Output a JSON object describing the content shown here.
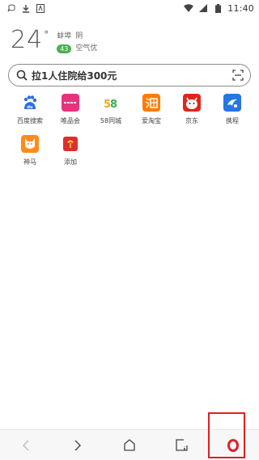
{
  "status_bar": {
    "time": "11:40"
  },
  "weather": {
    "temperature": "24",
    "degree_symbol": "°",
    "city": "蚌埠",
    "condition": "阴",
    "aqi_value": "43",
    "aqi_text": "空气优"
  },
  "search": {
    "text": "拉1人住院给300元"
  },
  "speed_dials": [
    {
      "label": "百度搜索",
      "icon": "baidu-icon",
      "color": "#2a6ee0",
      "glyph": ""
    },
    {
      "label": "唯品会",
      "icon": "vip-icon",
      "color": "#e8327c",
      "glyph": ""
    },
    {
      "label": "58同城",
      "icon": "58-icon",
      "color": "#ffffff",
      "glyph": "58"
    },
    {
      "label": "爱淘宝",
      "icon": "taobao-icon",
      "color": "#ff7a00",
      "glyph": "淘"
    },
    {
      "label": "京东",
      "icon": "jd-icon",
      "color": "#e1251b",
      "glyph": ""
    },
    {
      "label": "携程",
      "icon": "ctrip-icon",
      "color": "#2577e3",
      "glyph": ""
    },
    {
      "label": "神马",
      "icon": "shenma-icon",
      "color": "#ff8c1a",
      "glyph": ""
    },
    {
      "label": "添加",
      "icon": "add-app-icon",
      "color": "#e02e2e",
      "glyph": ""
    }
  ],
  "colors": {
    "accent": "#e02020",
    "aqi_green": "#4caf50"
  }
}
